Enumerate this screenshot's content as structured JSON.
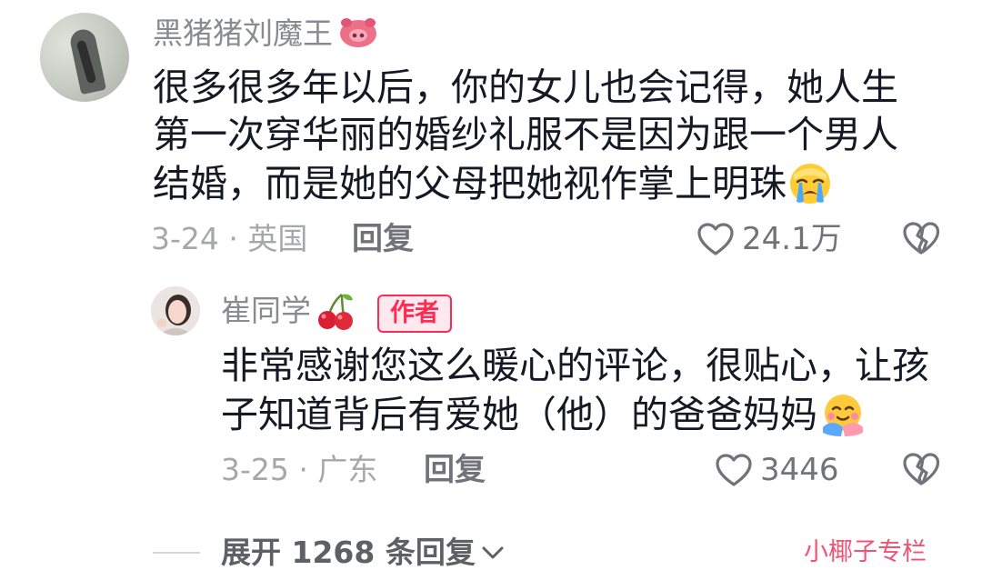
{
  "comment": {
    "username": "黑猪猪刘魔王",
    "username_icon": "pig-face-icon",
    "text_lines": [
      "很多很多年以后，你的女儿也会记得，她人生",
      "第一次穿华丽的婚纱礼服不是因为跟一个男人",
      "结婚，而是她的父母把她视作掌上明珠"
    ],
    "trailing_emoji": "crying-face-emoji",
    "date_location": "3-24 · 英国",
    "reply_label": "回复",
    "like_count": "24.1万",
    "like_icon": "heart-outline-icon",
    "dislike_icon": "broken-heart-icon"
  },
  "reply": {
    "username": "崔同学",
    "username_icon": "cherry-icon",
    "badge": "作者",
    "text_lines": [
      "非常感谢您这么暖心的评论，很贴心，让孩",
      "子知道背后有爱她（他）的爸爸妈妈"
    ],
    "trailing_emoji": "hugging-face-emoji",
    "date_location": "3-25 · 广东",
    "reply_label": "回复",
    "like_count": "3446"
  },
  "expand": {
    "label": "展开 1268 条回复"
  },
  "watermark": "小椰子专栏",
  "colors": {
    "text_primary": "#161823",
    "text_secondary": "#8a8b91",
    "accent": "#fe2c55"
  }
}
